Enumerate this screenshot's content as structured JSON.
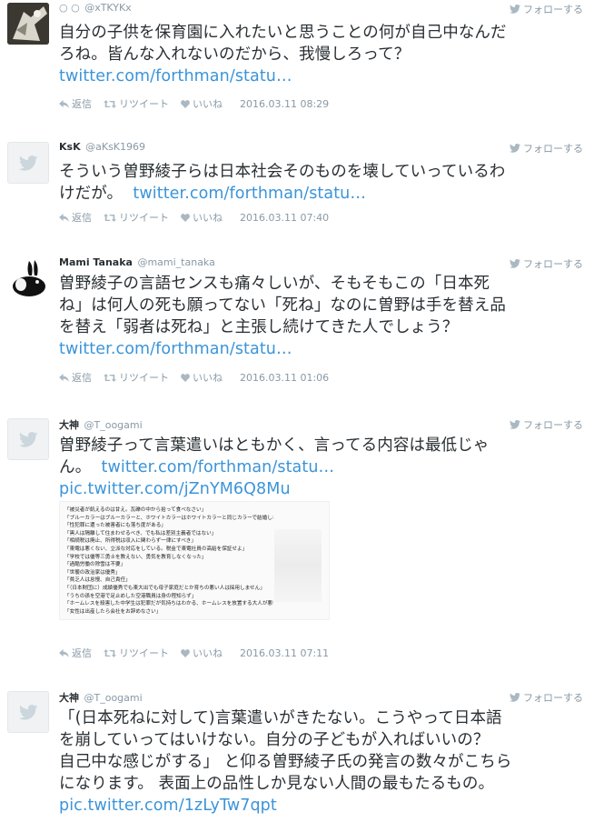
{
  "common": {
    "follow_label": "フォローする",
    "reply": "返信",
    "retweet": "リツイート",
    "like": "いいね"
  },
  "tweets": [
    {
      "name": "",
      "glyph_name": "○ ○",
      "handle": "@xTKYKx",
      "text_line1": "自分の子供を保育園に入れたいと思うことの何が自己中なんだ",
      "text_line2": "ろね。皆んな入れないのだから、我慢しろって？",
      "link1": "twitter.com/forthman/statu…",
      "date": "2016.03.11 08:29"
    },
    {
      "name": "KsK",
      "handle": "@aKsK1969",
      "text_line1": "そういう曽野綾子らは日本社会そのものを壊していっているわ",
      "text_line2": "けだが。",
      "link1": "twitter.com/forthman/statu…",
      "date": "2016.03.11 07:40"
    },
    {
      "name": "Mami Tanaka",
      "handle": "@mami_tanaka",
      "text_line1": "曽野綾子の言語センスも痛々しいが、そもそもこの「日本死",
      "text_line2": "ね」は何人の死も願ってない「死ね」なのに曽野は手を替え品",
      "text_line3": "を替え「弱者は死ね」と主張し続けてきた人でしょう？",
      "link1": "twitter.com/forthman/statu…",
      "date": "2016.03.11 01:06"
    },
    {
      "name": "大神",
      "handle": "@T_oogami",
      "text_line1": "曽野綾子って言葉遣いはともかく、言ってる内容は最低じゃ",
      "text_line2": "ん。",
      "link1": "twitter.com/forthman/statu…",
      "link2": "pic.twitter.com/jZnYM6Q8Mu",
      "media_lines": [
        "「被災者が飢えるのは甘え。瓦礫の中から拾って食べなさい」",
        "「ブルーカラーはブルーカラーと、ホワイトカラーはホワイトカラーと同じカラーで結婚しなさい」",
        "「性犯罪に遭った被害者にも落ち度がある」",
        "「黒人は隔離して住まわせるべき、でも私は差別主義者ではない」",
        "「相続税は廃止、所得税は収入に関わらず一律にすべき」",
        "「東電は悪くない、立派な対応をしている。税金で東電社員の高給を保証せよ」",
        "「学校では優等三勇士を教えない、勇気を教育しなくなった」",
        "「過酷労働の除雪は不要」",
        "「世襲の政治家は優秀」",
        "「貧乏人は怠慢、自己責任」",
        "「（日本財団に）成績優秀でも東大出でも母子家庭だとか育ちの悪い人は採用しません」",
        "「うちの孫を空港で足止めした空港職員は身の程知らず」",
        "「ホームレスを殺害した中学生は犯罪だが気持ちはわかる、ホームレスを放置する大人が悪い」",
        "「女性は出産したら会社をお辞めなさい」"
      ],
      "date": "2016.03.11 07:11"
    },
    {
      "name": "大神",
      "handle": "@T_oogami",
      "text_line1": "「(日本死ねに対して)言葉遣いがきたない。こうやって日本語",
      "text_line2": "を崩していってはいけない。自分の子どもが入ればいいの？",
      "text_line3": "自己中な感じがする」 と仰る曽野綾子氏の発言の数々がこちら",
      "text_line4": "になります。 表面上の品性しか見ない人間の最もたるもの。",
      "link2": "pic.twitter.com/1zLyTw7qpt"
    }
  ],
  "colors": {
    "link": "#3b94d9",
    "meta": "#8899a6",
    "text": "#292f33"
  },
  "icons": [
    "bird-icon",
    "reply-icon",
    "retweet-icon",
    "heart-icon",
    "follow-bird-icon"
  ]
}
